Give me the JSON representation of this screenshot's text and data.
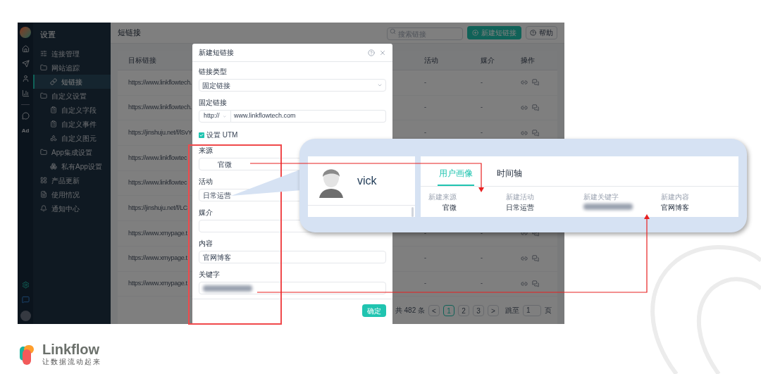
{
  "app": {
    "rail": {
      "ad_label": "Ad"
    },
    "sidebar": {
      "title": "设置",
      "items": [
        {
          "label": "连接管理",
          "selected": false
        },
        {
          "label": "网站追踪",
          "selected": false,
          "children": [
            {
              "label": "短链接",
              "selected": true
            }
          ]
        },
        {
          "label": "自定义设置",
          "selected": false,
          "children": [
            {
              "label": "自定义字段",
              "selected": false
            },
            {
              "label": "自定义事件",
              "selected": false
            },
            {
              "label": "自定义图元",
              "selected": false
            }
          ]
        },
        {
          "label": "App集成设置",
          "selected": false,
          "children": [
            {
              "label": "私有App设置",
              "selected": false
            }
          ]
        },
        {
          "label": "产品更新",
          "selected": false
        },
        {
          "label": "使用情况",
          "selected": false
        },
        {
          "label": "通知中心",
          "selected": false
        }
      ]
    },
    "header": {
      "title": "短链接",
      "search": {
        "placeholder": "搜索链接"
      },
      "new_button": "新建短链接",
      "help_button": "帮助"
    },
    "table": {
      "columns": [
        "目标链接",
        "活动",
        "媒介",
        "操作"
      ],
      "rows": [
        {
          "target": "https://www.linkflowtech.",
          "activity": "-",
          "medium": "-"
        },
        {
          "target": "https://www.linkflowtech.",
          "activity": "-",
          "medium": "-"
        },
        {
          "target": "https://jinshuju.net/f/lSvY",
          "activity": "-",
          "medium": "-"
        },
        {
          "target": "https://www.linkflowtec"
        },
        {
          "target": "https://www.linkflowtec"
        },
        {
          "target": "https://jinshuju.net/f/LC"
        },
        {
          "target": "https://www.xmypage.t",
          "activity": "-",
          "medium": "-"
        },
        {
          "target": "https://www.xmypage.t",
          "activity": "-",
          "medium": "-"
        },
        {
          "target": "https://www.xmypage.t",
          "activity": "-",
          "medium": "-"
        }
      ]
    },
    "pagination": {
      "total": "共 482 条",
      "prev": "<",
      "pages": [
        {
          "label": "1",
          "selected": true
        },
        {
          "label": "2",
          "selected": false
        },
        {
          "label": "3",
          "selected": false
        }
      ],
      "next": ">",
      "jump_label": "跳至",
      "jump_value": "1",
      "unit": "页"
    }
  },
  "dialog": {
    "title": "新建短链接",
    "link_type": {
      "label": "链接类型",
      "value": "固定链接"
    },
    "fixed_link": {
      "label": "固定链接",
      "protocol": "http://",
      "value": "www.linkflowtech.com"
    },
    "utm": {
      "label": "设置 UTM",
      "checked": true
    },
    "fields": [
      {
        "label": "来源",
        "value": "官微",
        "blurred": false
      },
      {
        "label": "活动",
        "value": "日常运营",
        "blurred": false
      },
      {
        "label": "媒介",
        "blurred": false
      },
      {
        "label": "内容",
        "value": "官网博客",
        "blurred": false
      },
      {
        "label": "关键字",
        "blurred": true
      }
    ],
    "confirm_button": "确定"
  },
  "callout": {
    "user_name": "vick",
    "tabs": [
      {
        "label": "用户画像",
        "selected": true
      },
      {
        "label": "时间轴",
        "selected": false
      }
    ],
    "attributes": [
      {
        "label": "新建来源",
        "value": "官微",
        "blurred": false
      },
      {
        "label": "新建活动",
        "value": "日常运营",
        "blurred": false
      },
      {
        "label": "新建关键字",
        "blurred": true
      },
      {
        "label": "新建内容",
        "value": "官网博客",
        "blurred": false
      }
    ]
  },
  "brand": {
    "name": "Linkflow",
    "tagline": "让数据流动起来"
  }
}
